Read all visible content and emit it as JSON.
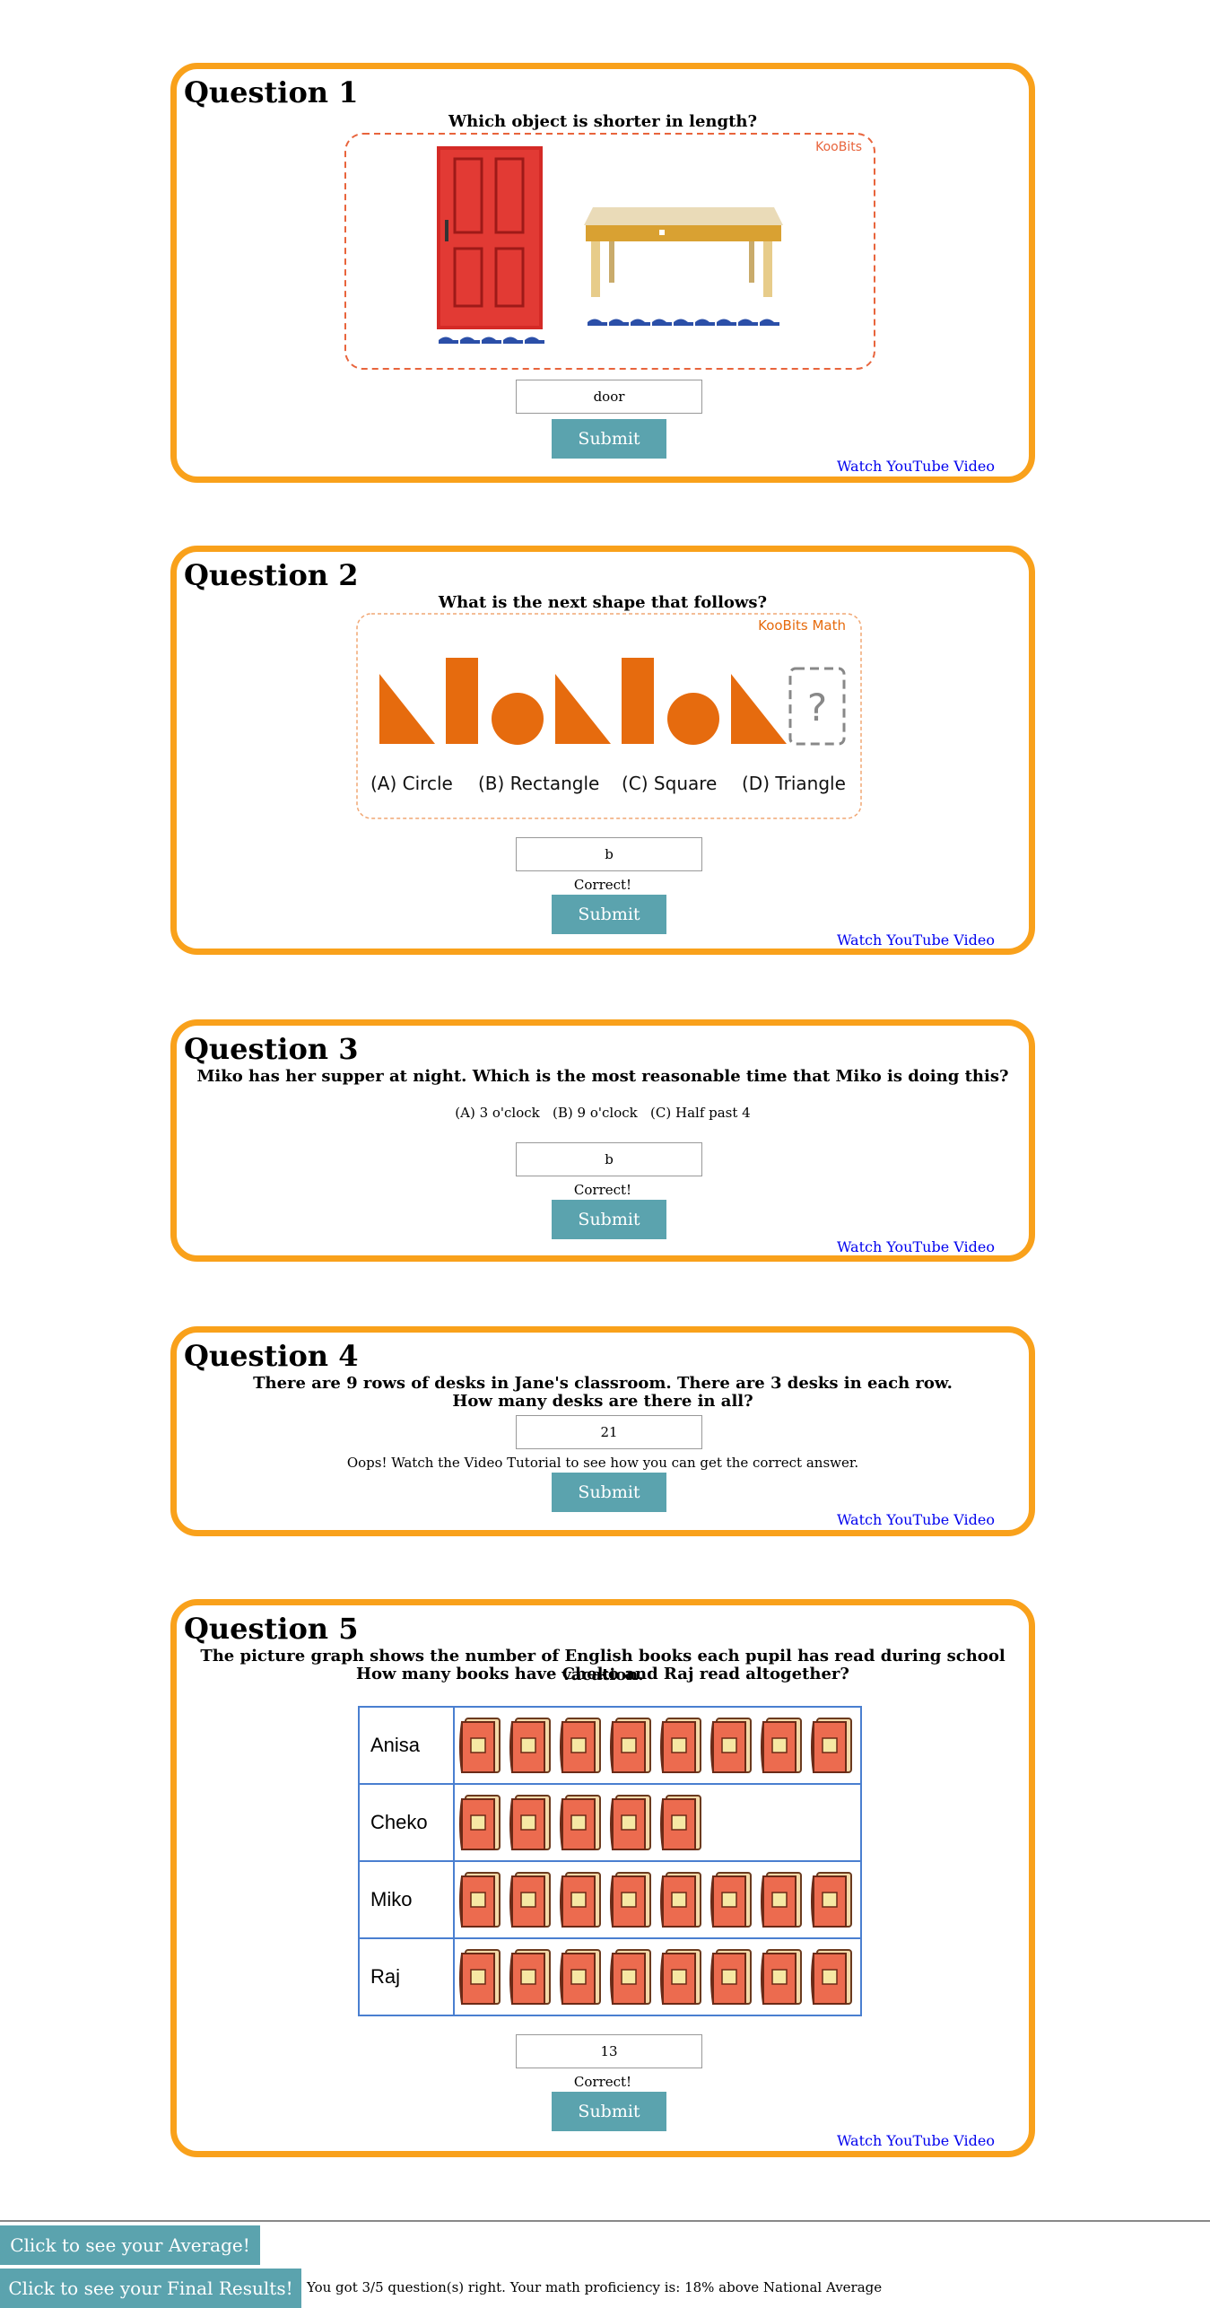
{
  "q1": {
    "title": "Question 1",
    "text": "Which object is shorter in length?",
    "watermark": "KooBits",
    "answer": "door",
    "submit": "Submit",
    "youtube": "Watch YouTube Video"
  },
  "q2": {
    "title": "Question 2",
    "text": "What is the next shape that follows?",
    "watermark": "KooBits Math",
    "placeholder_mark": "?",
    "options": [
      "(A) Circle",
      "(B) Rectangle",
      "(C) Square",
      "(D) Triangle"
    ],
    "answer": "b",
    "feedback": "Correct!",
    "submit": "Submit",
    "youtube": "Watch YouTube Video"
  },
  "q3": {
    "title": "Question 3",
    "text": "Miko has her supper at night. Which is the most reasonable time that Miko is doing this?",
    "options": "(A) 3 o'clock   (B) 9 o'clock   (C) Half past 4",
    "answer": "b",
    "feedback": "Correct!",
    "submit": "Submit",
    "youtube": "Watch YouTube Video"
  },
  "q4": {
    "title": "Question 4",
    "text_line1": "There are 9 rows of desks in Jane's classroom. There are 3 desks in each row.",
    "text_line2": "How many desks are there in all?",
    "answer": "21",
    "feedback": "Oops! Watch the Video Tutorial to see how you can get the correct answer.",
    "submit": "Submit",
    "youtube": "Watch YouTube Video"
  },
  "q5": {
    "title": "Question 5",
    "text_line1": "The picture graph shows the number of English books each pupil has read during school vacation.",
    "text_line2": "How many books have Cheko and Raj read altogether?",
    "graph": [
      {
        "name": "Anisa",
        "books": 8
      },
      {
        "name": "Cheko",
        "books": 5
      },
      {
        "name": "Miko",
        "books": 8
      },
      {
        "name": "Raj",
        "books": 8
      }
    ],
    "answer": "13",
    "feedback": "Correct!",
    "submit": "Submit",
    "youtube": "Watch YouTube Video"
  },
  "footer": {
    "average_button": "Click to see your Average!",
    "final_button": "Click to see your Final Results!",
    "result_text": "You got 3/5 question(s) right. Your math proficiency is: 18% above National Average"
  },
  "colors": {
    "card_border": "#f9a11b",
    "button": "#5ba3ae",
    "shape": "#e66b0e",
    "link": "#0000ee"
  }
}
